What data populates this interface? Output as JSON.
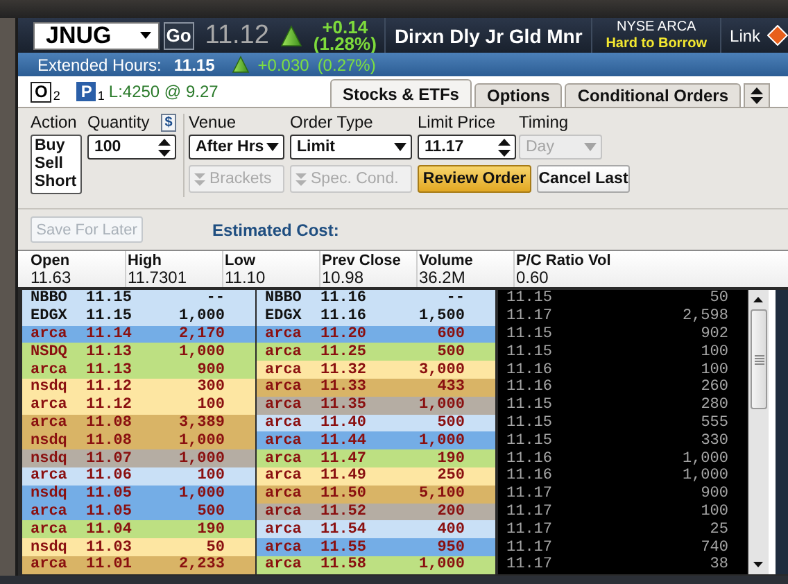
{
  "header": {
    "symbol": "JNUG",
    "go": "Go",
    "last": "11.12",
    "rising": true,
    "change": "+0.14",
    "change_pct": "(1.28%)",
    "description": "Dirxn Dly Jr Gld Mnr",
    "exchange": "NYSE ARCA",
    "borrow_status": "Hard to Borrow",
    "link": "Link"
  },
  "extended_hours": {
    "label": "Extended Hours:",
    "price": "11.15",
    "rising": true,
    "change": "+0.030",
    "change_pct": "(0.27%)"
  },
  "position_bar": {
    "orders_badge": "O",
    "orders_count": "2",
    "positions_badge": "P",
    "positions_count": "1",
    "position": "L:4250 @ 9.27"
  },
  "tabs": [
    {
      "label": "Stocks & ETFs",
      "selected": true
    },
    {
      "label": "Options",
      "selected": false
    },
    {
      "label": "Conditional Orders",
      "selected": false
    }
  ],
  "order": {
    "action": {
      "label": "Action",
      "options": [
        {
          "label": "Buy",
          "selected": false
        },
        {
          "label": "Sell",
          "selected": false
        },
        {
          "label": "Short",
          "selected": false
        }
      ]
    },
    "quantity": {
      "label": "Quantity",
      "value": "100",
      "dollar_toggle": "$"
    },
    "venue": {
      "label": "Venue",
      "value": "After Hrs"
    },
    "order_type": {
      "label": "Order Type",
      "value": "Limit"
    },
    "limit_price": {
      "label": "Limit Price",
      "value": "11.17"
    },
    "timing": {
      "label": "Timing",
      "value": "Day",
      "disabled": true
    },
    "buttons": [
      {
        "label": "Brackets",
        "kind": "dropdown",
        "disabled": true
      },
      {
        "label": "Spec. Cond.",
        "kind": "dropdown",
        "disabled": true
      },
      {
        "label": "Review Order",
        "kind": "primary",
        "disabled": false
      },
      {
        "label": "Cancel Last",
        "kind": "plain",
        "disabled": false
      }
    ],
    "save_for_later": {
      "label": "Save For Later",
      "disabled": true
    },
    "estimated_cost_label": "Estimated Cost:"
  },
  "stats": [
    {
      "label": "Open",
      "value": "11.63"
    },
    {
      "label": "High",
      "value": "11.7301"
    },
    {
      "label": "Low",
      "value": "11.10"
    },
    {
      "label": "Prev Close",
      "value": "10.98"
    },
    {
      "label": "Volume",
      "value": "36.2M"
    },
    {
      "label": "P/C Ratio Vol",
      "value": "0.60"
    }
  ],
  "book": {
    "bids": [
      {
        "venue": "NBBO",
        "price": "11.15",
        "size": "--",
        "kind": "best",
        "color": "#c9e0f6"
      },
      {
        "venue": "EDGX",
        "price": "11.15",
        "size": "1,000",
        "kind": "best",
        "color": "#c9e0f6"
      },
      {
        "venue": "arca",
        "price": "11.14",
        "size": "2,170",
        "kind": "level",
        "color": "#74ade6"
      },
      {
        "venue": "NSDQ",
        "price": "11.13",
        "size": "1,000",
        "kind": "level",
        "color": "#bde082"
      },
      {
        "venue": "arca",
        "price": "11.13",
        "size": "900",
        "kind": "level",
        "color": "#bde082"
      },
      {
        "venue": "nsdq",
        "price": "11.12",
        "size": "300",
        "kind": "level",
        "color": "#fde6a2"
      },
      {
        "venue": "arca",
        "price": "11.12",
        "size": "100",
        "kind": "level",
        "color": "#fde6a2"
      },
      {
        "venue": "arca",
        "price": "11.08",
        "size": "3,389",
        "kind": "level",
        "color": "#d9b466"
      },
      {
        "venue": "nsdq",
        "price": "11.08",
        "size": "1,000",
        "kind": "level",
        "color": "#d9b466"
      },
      {
        "venue": "nsdq",
        "price": "11.07",
        "size": "1,000",
        "kind": "level",
        "color": "#b5ada3"
      },
      {
        "venue": "arca",
        "price": "11.06",
        "size": "100",
        "kind": "level",
        "color": "#c9e0f6"
      },
      {
        "venue": "nsdq",
        "price": "11.05",
        "size": "1,000",
        "kind": "level",
        "color": "#74ade6"
      },
      {
        "venue": "arca",
        "price": "11.05",
        "size": "500",
        "kind": "level",
        "color": "#74ade6"
      },
      {
        "venue": "arca",
        "price": "11.04",
        "size": "190",
        "kind": "level",
        "color": "#bde082"
      },
      {
        "venue": "nsdq",
        "price": "11.03",
        "size": "50",
        "kind": "level",
        "color": "#fde6a2"
      },
      {
        "venue": "arca",
        "price": "11.01",
        "size": "2,233",
        "kind": "level",
        "color": "#d9b466"
      }
    ],
    "asks": [
      {
        "venue": "NBBO",
        "price": "11.16",
        "size": "--",
        "kind": "best",
        "color": "#c9e0f6"
      },
      {
        "venue": "EDGX",
        "price": "11.16",
        "size": "1,500",
        "kind": "best",
        "color": "#c9e0f6"
      },
      {
        "venue": "arca",
        "price": "11.20",
        "size": "600",
        "kind": "level",
        "color": "#74ade6"
      },
      {
        "venue": "arca",
        "price": "11.25",
        "size": "500",
        "kind": "level",
        "color": "#bde082"
      },
      {
        "venue": "arca",
        "price": "11.32",
        "size": "3,000",
        "kind": "level",
        "color": "#fde6a2"
      },
      {
        "venue": "arca",
        "price": "11.33",
        "size": "433",
        "kind": "level",
        "color": "#d9b466"
      },
      {
        "venue": "arca",
        "price": "11.35",
        "size": "1,000",
        "kind": "level",
        "color": "#b5ada3"
      },
      {
        "venue": "arca",
        "price": "11.40",
        "size": "500",
        "kind": "level",
        "color": "#c9e0f6"
      },
      {
        "venue": "arca",
        "price": "11.44",
        "size": "1,000",
        "kind": "level",
        "color": "#74ade6"
      },
      {
        "venue": "arca",
        "price": "11.47",
        "size": "190",
        "kind": "level",
        "color": "#bde082"
      },
      {
        "venue": "arca",
        "price": "11.49",
        "size": "250",
        "kind": "level",
        "color": "#fde6a2"
      },
      {
        "venue": "arca",
        "price": "11.50",
        "size": "5,100",
        "kind": "level",
        "color": "#d9b466"
      },
      {
        "venue": "arca",
        "price": "11.52",
        "size": "200",
        "kind": "level",
        "color": "#b5ada3"
      },
      {
        "venue": "arca",
        "price": "11.54",
        "size": "400",
        "kind": "level",
        "color": "#c9e0f6"
      },
      {
        "venue": "arca",
        "price": "11.55",
        "size": "950",
        "kind": "level",
        "color": "#74ade6"
      },
      {
        "venue": "arca",
        "price": "11.58",
        "size": "1,000",
        "kind": "level",
        "color": "#bde082"
      }
    ]
  },
  "time_and_sales": [
    {
      "price": "11.15",
      "size": "50"
    },
    {
      "price": "11.17",
      "size": "2,598"
    },
    {
      "price": "11.15",
      "size": "902"
    },
    {
      "price": "11.15",
      "size": "100"
    },
    {
      "price": "11.16",
      "size": "100"
    },
    {
      "price": "11.16",
      "size": "260"
    },
    {
      "price": "11.15",
      "size": "280"
    },
    {
      "price": "11.15",
      "size": "555"
    },
    {
      "price": "11.15",
      "size": "330"
    },
    {
      "price": "11.16",
      "size": "1,000"
    },
    {
      "price": "11.16",
      "size": "1,000"
    },
    {
      "price": "11.17",
      "size": "900"
    },
    {
      "price": "11.17",
      "size": "100"
    },
    {
      "price": "11.17",
      "size": "25"
    },
    {
      "price": "11.17",
      "size": "740"
    },
    {
      "price": "11.17",
      "size": "38"
    }
  ]
}
